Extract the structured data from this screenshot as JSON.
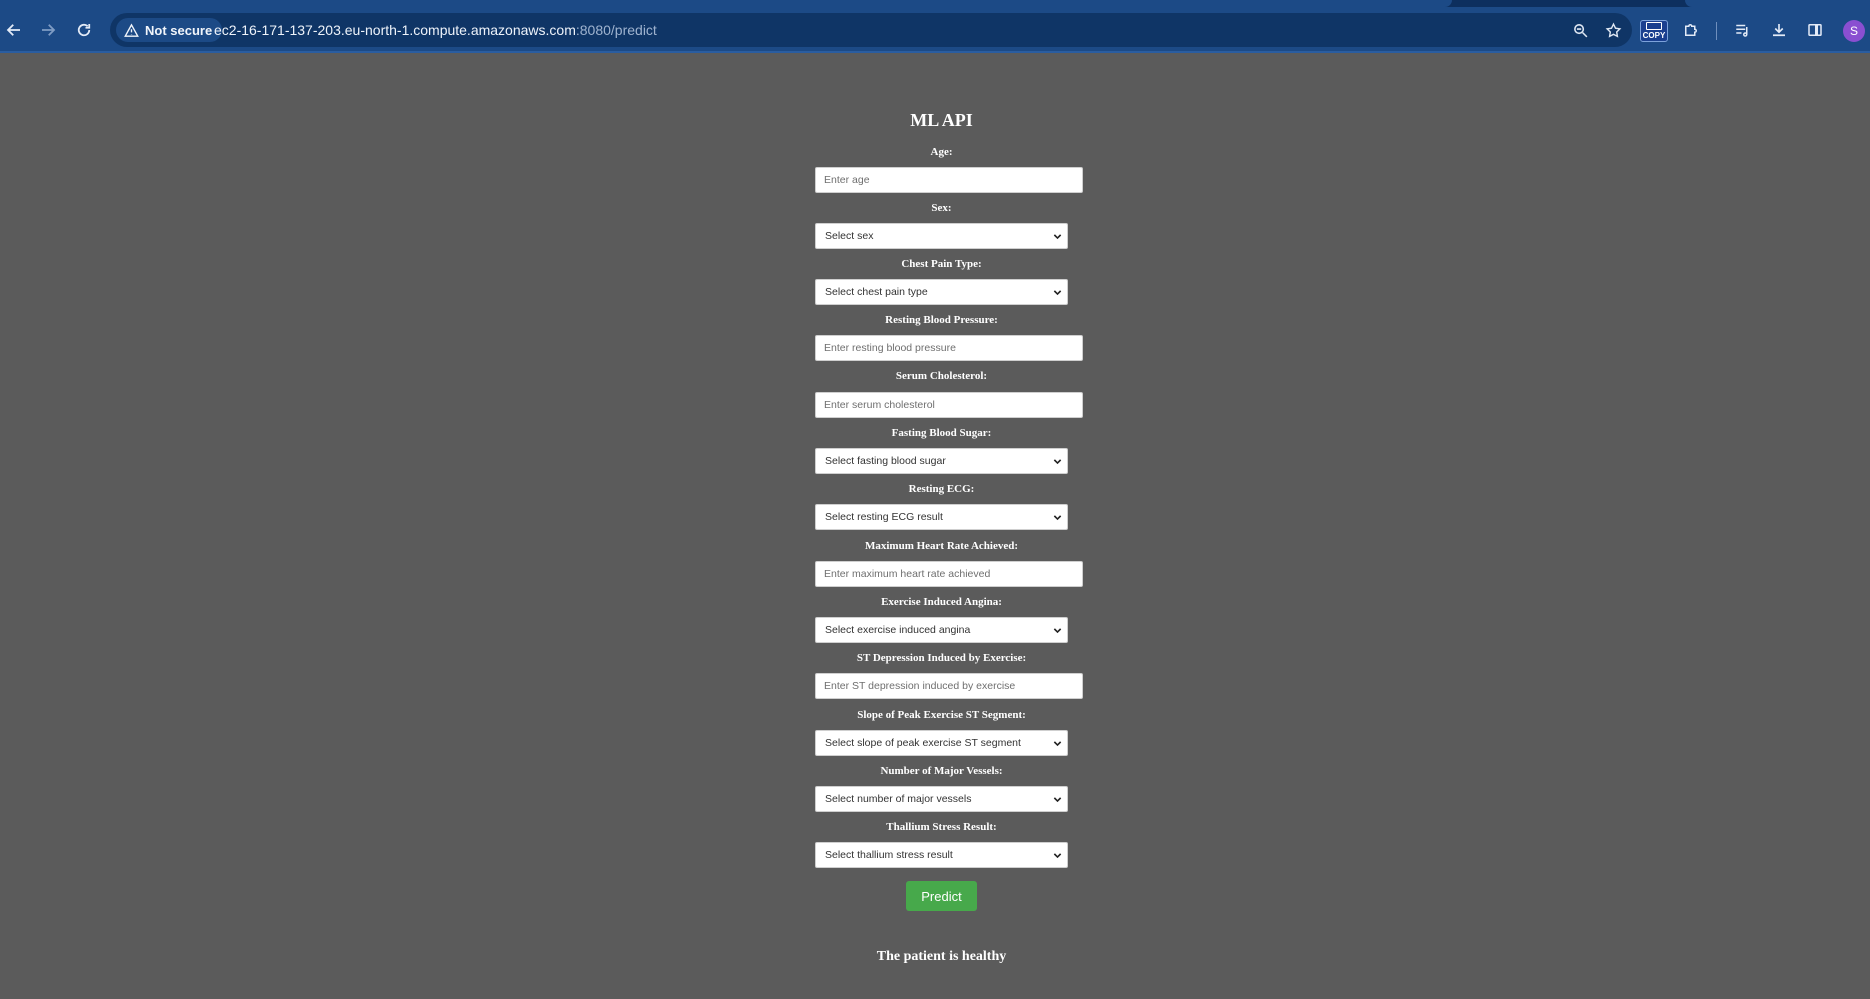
{
  "browser": {
    "security_label": "Not secure",
    "url_host": "ec2-16-171-137-203.eu-north-1.compute.amazonaws.com",
    "url_path": ":8080/predict",
    "copy_ext_label": "COPY",
    "profile_initial": "S"
  },
  "page": {
    "title": "ML API",
    "fields": [
      {
        "label": "Age:",
        "type": "input",
        "placeholder": "Enter age"
      },
      {
        "label": "Sex:",
        "type": "select",
        "selected": "Select sex"
      },
      {
        "label": "Chest Pain Type:",
        "type": "select",
        "selected": "Select chest pain type"
      },
      {
        "label": "Resting Blood Pressure:",
        "type": "input",
        "placeholder": "Enter resting blood pressure"
      },
      {
        "label": "Serum Cholesterol:",
        "type": "input",
        "placeholder": "Enter serum cholesterol"
      },
      {
        "label": "Fasting Blood Sugar:",
        "type": "select",
        "selected": "Select fasting blood sugar"
      },
      {
        "label": "Resting ECG:",
        "type": "select",
        "selected": "Select resting ECG result"
      },
      {
        "label": "Maximum Heart Rate Achieved:",
        "type": "input",
        "placeholder": "Enter maximum heart rate achieved"
      },
      {
        "label": "Exercise Induced Angina:",
        "type": "select",
        "selected": "Select exercise induced angina"
      },
      {
        "label": "ST Depression Induced by Exercise:",
        "type": "input",
        "placeholder": "Enter ST depression induced by exercise"
      },
      {
        "label": "Slope of Peak Exercise ST Segment:",
        "type": "select",
        "selected": "Select slope of peak exercise ST segment"
      },
      {
        "label": "Number of Major Vessels:",
        "type": "select",
        "selected": "Select number of major vessels"
      },
      {
        "label": "Thallium Stress Result:",
        "type": "select",
        "selected": "Select thallium stress result"
      }
    ],
    "predict_label": "Predict",
    "result_text": "The patient is healthy"
  },
  "colors": {
    "page_bg": "#5b5b5b",
    "toolbar_bg": "#1c4a86",
    "button_green": "#47a94b"
  }
}
